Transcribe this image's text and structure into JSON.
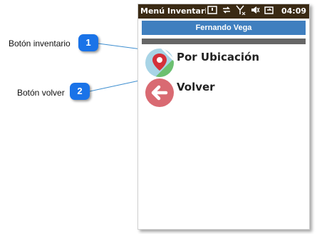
{
  "status_bar": {
    "title": "Menú Inventario",
    "time": "04:09",
    "icons": [
      "sip-icon",
      "sync-icon",
      "signal-off-icon",
      "volume-mute-icon",
      "battery-charging-icon"
    ]
  },
  "header": {
    "user_name": "Fernando Vega"
  },
  "menu": {
    "items": [
      {
        "label": "Por Ubicación",
        "icon": "map-pin-icon"
      },
      {
        "label": "Volver",
        "icon": "arrow-left-icon"
      }
    ]
  },
  "annotations": [
    {
      "number": "1",
      "label": "Botón inventario"
    },
    {
      "number": "2",
      "label": "Botón volver"
    }
  ],
  "colors": {
    "status_bar": "#3a2a14",
    "header": "#3f7fbf",
    "divider": "#666666",
    "badge": "#1a73e8",
    "back_circle": "#d96a72",
    "map_circle": "#a8d4e6"
  }
}
